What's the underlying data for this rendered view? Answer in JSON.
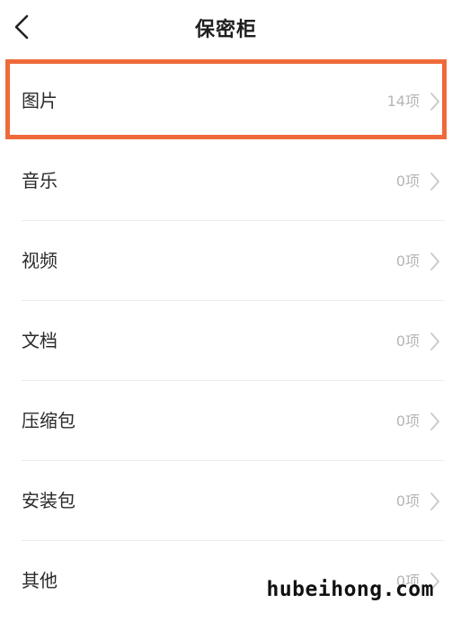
{
  "header": {
    "title": "保密柜"
  },
  "items": [
    {
      "label": "图片",
      "count": "14项",
      "highlighted": true
    },
    {
      "label": "音乐",
      "count": "0项"
    },
    {
      "label": "视频",
      "count": "0项"
    },
    {
      "label": "文档",
      "count": "0项"
    },
    {
      "label": "压缩包",
      "count": "0项"
    },
    {
      "label": "安装包",
      "count": "0项"
    },
    {
      "label": "其他",
      "count": "0项"
    }
  ],
  "watermark": "hubeihong.com",
  "colors": {
    "highlight_border": "#ef6a3a",
    "count_text": "#b5b5b5"
  }
}
